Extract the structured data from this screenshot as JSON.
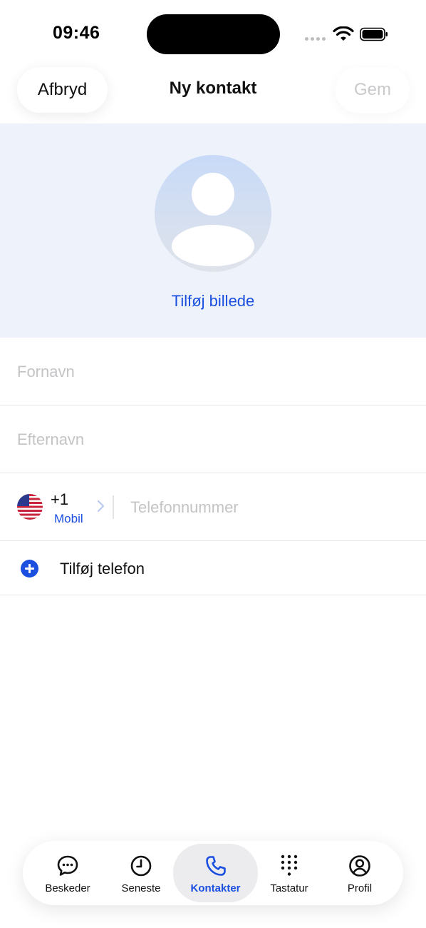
{
  "status_bar": {
    "time": "09:46"
  },
  "nav": {
    "cancel_label": "Afbryd",
    "title": "Ny kontakt",
    "save_label": "Gem"
  },
  "photo": {
    "add_label": "Tilføj billede"
  },
  "form": {
    "first_name": {
      "placeholder": "Fornavn",
      "value": ""
    },
    "last_name": {
      "placeholder": "Efternavn",
      "value": ""
    },
    "phone": {
      "country_flag": "us-flag-icon",
      "country_code": "+1",
      "type": "Mobil",
      "placeholder": "Telefonnummer",
      "value": ""
    },
    "add_phone_label": "Tilføj telefon"
  },
  "tabbar": {
    "items": [
      {
        "label": "Beskeder",
        "icon": "chat-bubble-icon",
        "active": false
      },
      {
        "label": "Seneste",
        "icon": "clock-icon",
        "active": false
      },
      {
        "label": "Kontakter",
        "icon": "phone-icon",
        "active": true
      },
      {
        "label": "Tastatur",
        "icon": "keypad-icon",
        "active": false
      },
      {
        "label": "Profil",
        "icon": "profile-icon",
        "active": false
      }
    ]
  },
  "colors": {
    "accent": "#1a4fe0",
    "photo_bg": "#edf2fb",
    "placeholder": "#c4c4c7",
    "divider": "#e4e4e6"
  }
}
